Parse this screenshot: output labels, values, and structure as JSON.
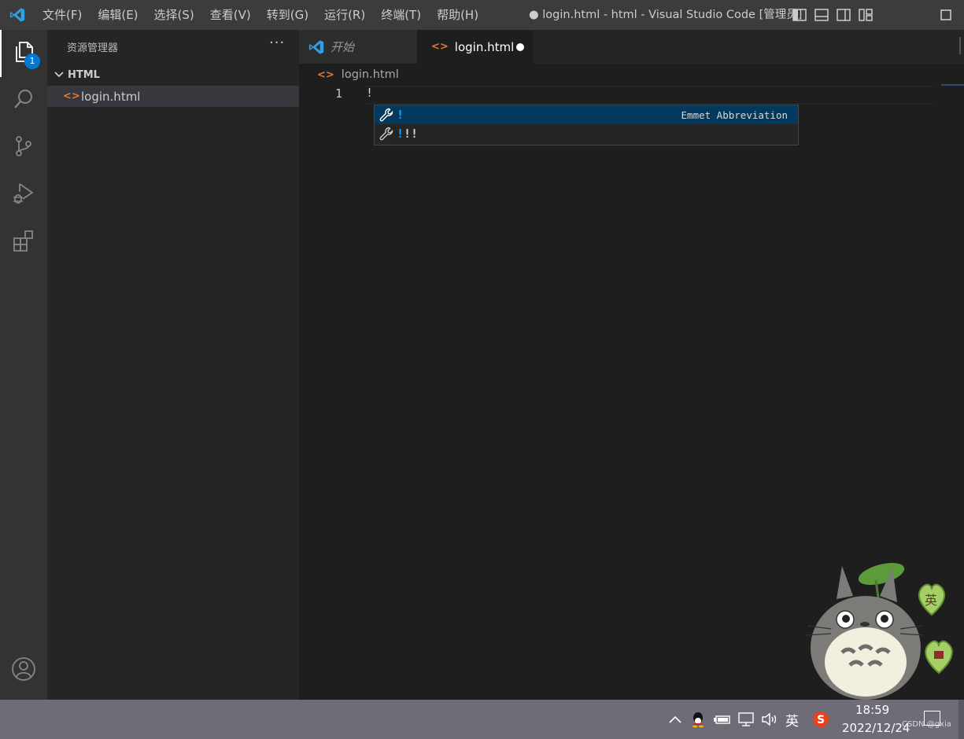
{
  "titlebar": {
    "menu": [
      "文件(F)",
      "编辑(E)",
      "选择(S)",
      "查看(V)",
      "转到(G)",
      "运行(R)",
      "终端(T)",
      "帮助(H)"
    ],
    "window_title": "● login.html - html - Visual Studio Code [管理员]"
  },
  "activitybar": {
    "items": [
      "explorer-icon",
      "search-icon",
      "source-control-icon",
      "run-debug-icon",
      "extensions-icon",
      "account-icon"
    ],
    "explorer_badge": "1"
  },
  "sidebar": {
    "title": "资源管理器",
    "more": "···",
    "folder": "HTML",
    "files": [
      {
        "icon": "<>",
        "name": "login.html"
      }
    ]
  },
  "editor": {
    "tabs": [
      {
        "label": "开始",
        "icon": "vscode-logo-icon"
      },
      {
        "label": "login.html",
        "icon": "<>",
        "modified": true
      }
    ],
    "breadcrumb": "login.html",
    "breadcrumb_icon": "<>",
    "lines": [
      {
        "number": "1",
        "text": "!"
      }
    ]
  },
  "suggest": {
    "items": [
      {
        "highlight": "!",
        "rest": "",
        "detail": "Emmet Abbreviation"
      },
      {
        "highlight": "!",
        "rest": "!!",
        "detail": ""
      }
    ]
  },
  "taskbar": {
    "ime": "英",
    "time": "18:59",
    "date": "2022/12/24",
    "watermark": "CSDN @gxia",
    "tray_icons": [
      "chevron-up-icon",
      "qq-icon",
      "battery-icon",
      "network-icon",
      "volume-icon",
      "sogou-icon",
      "notification-icon"
    ]
  },
  "desktop_pet": {
    "heart_text": "英"
  },
  "colors": {
    "accent": "#0078d4",
    "html_icon": "#e37933",
    "selected_suggestion": "#04395e",
    "match_highlight": "#18a3ff"
  }
}
